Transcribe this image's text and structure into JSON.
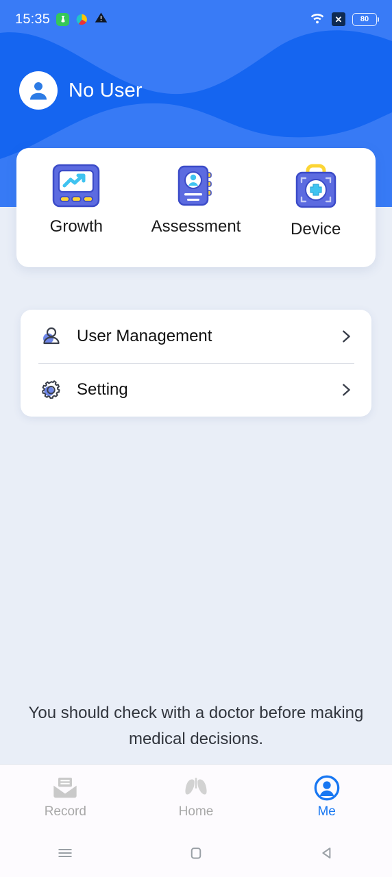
{
  "status_bar": {
    "time": "15:35",
    "battery_level": "80",
    "icons": [
      "green-app-icon",
      "pill-app-icon",
      "warning-triangle-icon",
      "wifi-icon",
      "x-badge-icon",
      "battery-icon"
    ]
  },
  "header": {
    "user_name": "No User",
    "avatar_icon": "person-avatar-icon",
    "bg_color": "#1565F0",
    "wave_color": "#3B7CF5"
  },
  "quick_actions": [
    {
      "label": "Growth",
      "icon": "growth-monitor-icon"
    },
    {
      "label": "Assessment",
      "icon": "assessment-book-icon"
    },
    {
      "label": "Device",
      "icon": "device-medkit-icon"
    }
  ],
  "menu": [
    {
      "label": "User Management",
      "icon": "user-management-icon",
      "chevron": "chevron-right-icon"
    },
    {
      "label": "Setting",
      "icon": "gear-icon",
      "chevron": "chevron-right-icon"
    }
  ],
  "disclaimer": {
    "text": "You should check with a doctor before making medical decisions."
  },
  "tabbar": {
    "active": "Me",
    "accent_color": "#1877F2",
    "inactive_color": "#A8A8A8",
    "items": [
      {
        "label": "Record",
        "icon": "record-envelope-icon",
        "active": false
      },
      {
        "label": "Home",
        "icon": "lungs-icon",
        "active": false
      },
      {
        "label": "Me",
        "icon": "person-circle-icon",
        "active": true
      }
    ]
  },
  "system_nav": {
    "buttons": [
      {
        "icon": "recents-menu-icon"
      },
      {
        "icon": "home-square-icon"
      },
      {
        "icon": "back-triangle-icon"
      }
    ]
  }
}
